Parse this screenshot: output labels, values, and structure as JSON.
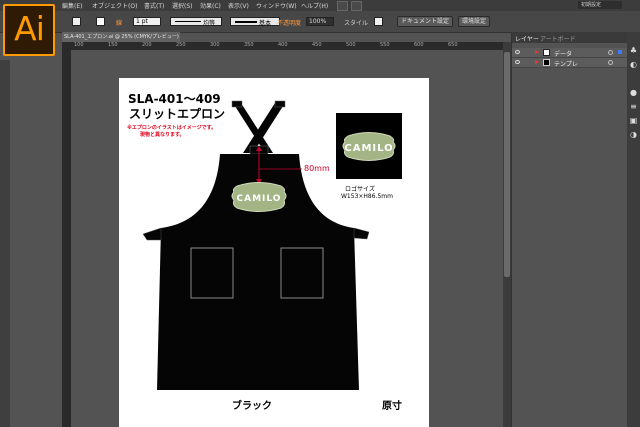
{
  "app": {
    "logo_text": "Ai"
  },
  "menu": {
    "items": [
      "編集(E)",
      "オブジェクト(O)",
      "書式(T)",
      "選択(S)",
      "効果(C)",
      "表示(V)",
      "ウィンドウ(W)",
      "ヘルプ(H)"
    ],
    "workspace": "初期設定"
  },
  "control_bar": {
    "stroke_label": "線",
    "stroke_weight": "1 pt",
    "profile_value": "均等",
    "brush_value": "基本",
    "opacity_label": "不透明度",
    "opacity_value": "100%",
    "style_label": "スタイル",
    "document_setup_button": "ドキュメント設定",
    "preferences_button": "環境設定"
  },
  "document": {
    "tab_title": "SLA-401_エプロン.ai @ 25% (CMYK/プレビュー)",
    "close_glyph": "×"
  },
  "ruler": {
    "labels": [
      "100",
      "150",
      "200",
      "250",
      "300",
      "350",
      "400",
      "450",
      "500",
      "550",
      "600",
      "650"
    ]
  },
  "artboard": {
    "product_code": "SLA-401〜409",
    "product_name": "スリットエプロン",
    "note_line1": "※エプロンのイラストはイメージです。",
    "note_line2": "現物と異なります。",
    "logo_text": "CAMILO",
    "logo_size_line1": "ロゴサイズ",
    "logo_size_line2": "W153×H86.5mm",
    "dimension_label": "80mm",
    "color_name": "ブラック",
    "scale_label": "原寸"
  },
  "layers_panel": {
    "tabs": [
      "レイヤー",
      "アートボード"
    ],
    "rows": [
      {
        "name": "データ",
        "selected": true
      },
      {
        "name": "テンプレ",
        "selected": false
      }
    ]
  },
  "colors": {
    "apron": "#050505",
    "logo_green": "#a3b585",
    "dimension_red": "#c8002d",
    "note_red": "#e0001a",
    "ai_orange": "#ff9a00"
  }
}
